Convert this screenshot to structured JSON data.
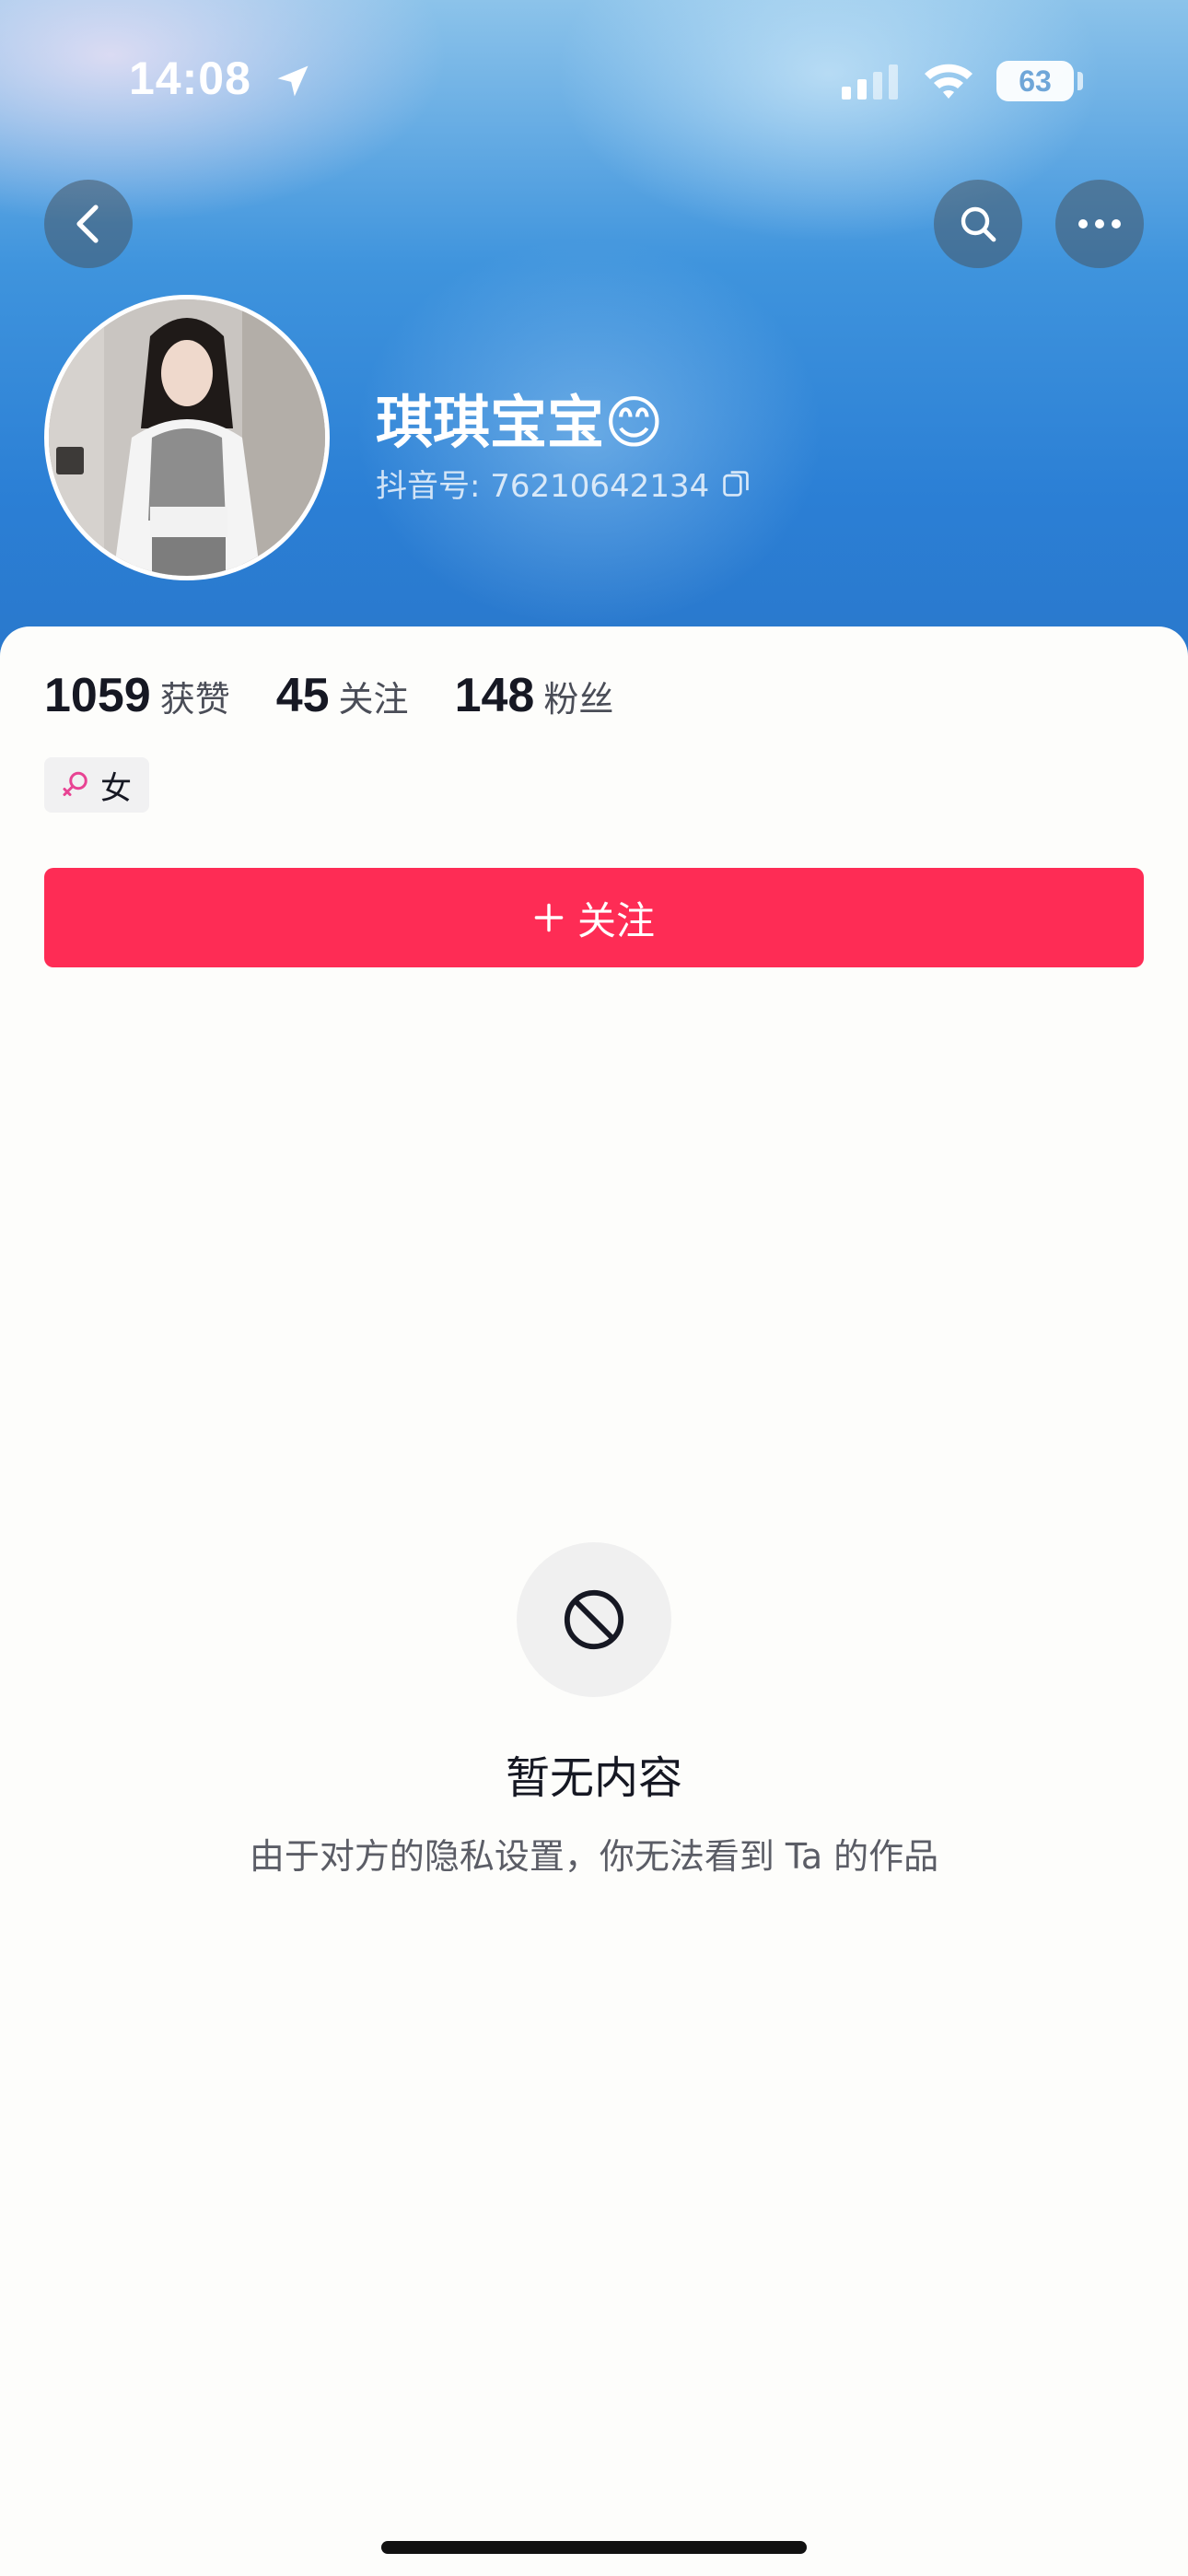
{
  "status_bar": {
    "time": "14:08",
    "battery": "63"
  },
  "profile": {
    "username": "琪琪宝宝😊",
    "douyin_id": "抖音号: 76210642134"
  },
  "stats": {
    "likes_value": "1059",
    "likes_label": "获赞",
    "following_value": "45",
    "following_label": "关注",
    "followers_value": "148",
    "followers_label": "粉丝"
  },
  "gender_tag": "女",
  "follow_button": "关注",
  "empty_state": {
    "title": "暂无内容",
    "description": "由于对方的隐私设置，你无法看到 Ta 的作品"
  },
  "colors": {
    "accent": "#fe2c55",
    "header_blue": "#2b7fd5",
    "gender_pink": "#e84393"
  }
}
